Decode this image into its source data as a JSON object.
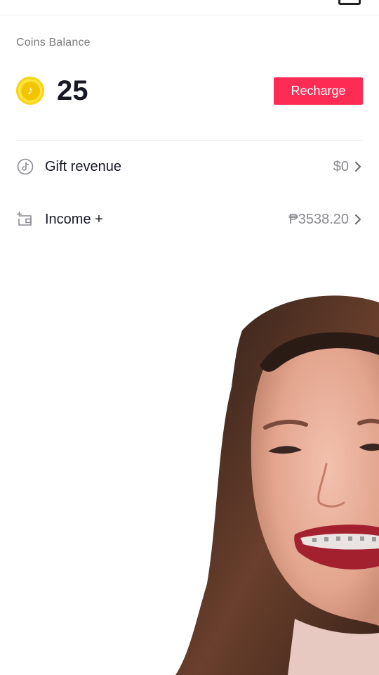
{
  "wallet": {
    "coins_label": "Coins Balance",
    "coin_balance": "25",
    "recharge_label": "Recharge"
  },
  "rows": [
    {
      "label": "Gift revenue",
      "value": "$0",
      "icon": "tiktok-note-icon"
    },
    {
      "label": "Income +",
      "value": "₱3538.20",
      "icon": "wallet-plus-icon"
    }
  ],
  "colors": {
    "accent": "#fe2c55",
    "coin": "#ffe63b",
    "text_primary": "#161823",
    "text_secondary": "#8a8b91"
  }
}
